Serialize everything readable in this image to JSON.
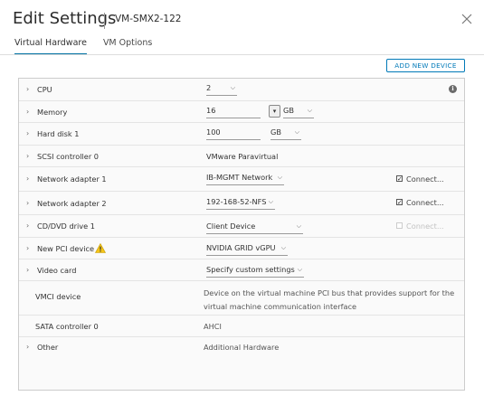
{
  "dialog": {
    "title": "Edit Settings",
    "vm_name": "VM-SMX2-122",
    "close_icon": "close-icon"
  },
  "tabs": [
    {
      "label": "Virtual Hardware",
      "active": true
    },
    {
      "label": "VM Options",
      "active": false
    }
  ],
  "add_device_label": "ADD NEW DEVICE",
  "rows": {
    "cpu": {
      "label": "CPU",
      "value": "2"
    },
    "memory": {
      "label": "Memory",
      "value": "16",
      "unit": "GB"
    },
    "hard_disk": {
      "label": "Hard disk 1",
      "value": "100",
      "unit": "GB"
    },
    "scsi": {
      "label": "SCSI controller 0",
      "value": "VMware Paravirtual"
    },
    "net1": {
      "label": "Network adapter 1",
      "value": "IB-MGMT Network",
      "connect_label": "Connect...",
      "connected": true
    },
    "net2": {
      "label": "Network adapter 2",
      "value": "192-168-52-NFS",
      "connect_label": "Connect...",
      "connected": true
    },
    "cdrom": {
      "label": "CD/DVD drive 1",
      "value": "Client Device",
      "connect_label": "Connect...",
      "connected": false
    },
    "pci": {
      "label": "New PCI device",
      "value": "NVIDIA GRID vGPU"
    },
    "video": {
      "label": "Video card",
      "value": "Specify custom settings"
    },
    "vmci": {
      "label": "VMCI device",
      "value_line1": "Device on the virtual machine PCI bus that provides support for the",
      "value_line2": "virtual machine communication interface"
    },
    "sata": {
      "label": "SATA controller 0",
      "value": "AHCI"
    },
    "other": {
      "label": "Other",
      "value": "Additional Hardware"
    }
  },
  "colors": {
    "accent": "#0079b8",
    "tab_underline": "#0072a3",
    "warning": "#f5c518"
  }
}
